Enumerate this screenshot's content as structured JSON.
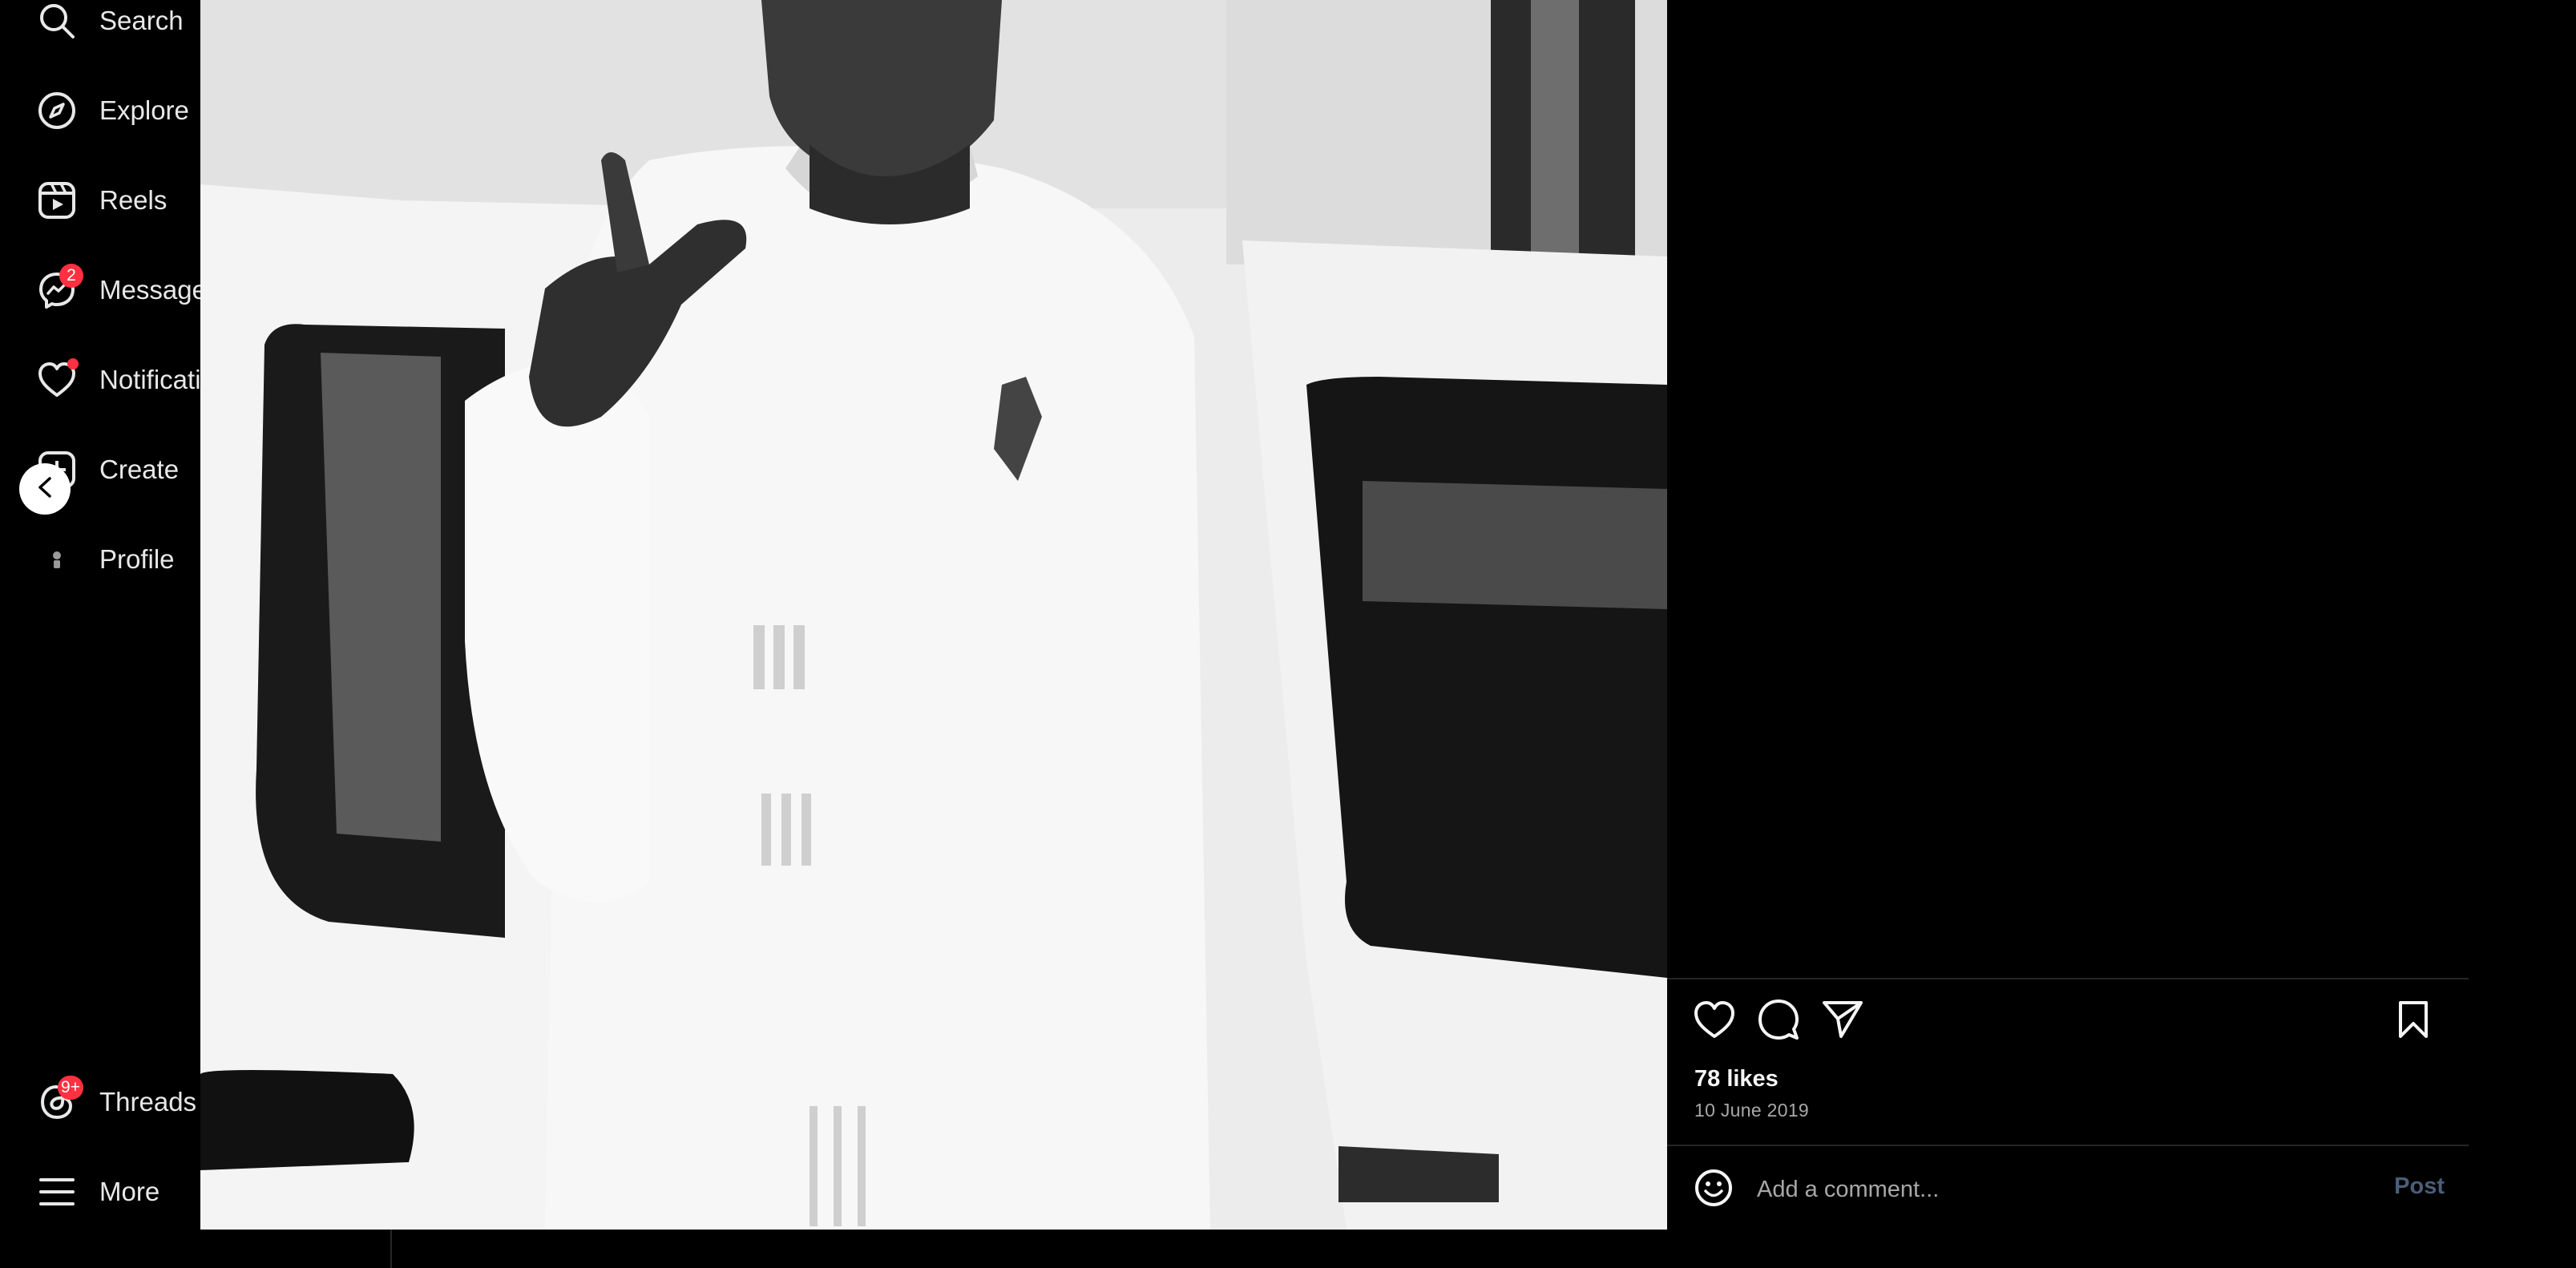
{
  "sidebar": {
    "items": [
      {
        "label": "Search",
        "icon": "search-icon"
      },
      {
        "label": "Explore",
        "icon": "compass-icon"
      },
      {
        "label": "Reels",
        "icon": "reels-icon"
      },
      {
        "label": "Messages",
        "icon": "messenger-icon",
        "badge": "2"
      },
      {
        "label": "Notifications",
        "icon": "heart-icon"
      },
      {
        "label": "Create",
        "icon": "plus-square-icon"
      },
      {
        "label": "Profile",
        "icon": "avatar"
      },
      {
        "label": "Threads",
        "icon": "threads-icon",
        "badge": "9+"
      },
      {
        "label": "More",
        "icon": "hamburger-icon"
      }
    ]
  },
  "post": {
    "likes": "78 likes",
    "date": "10 June 2019",
    "comment_placeholder": "Add a comment...",
    "post_label": "Post"
  },
  "colors": {
    "background": "#000000",
    "badge": "#ff3040",
    "post_button": "#4a5e7a",
    "muted_text": "#a8a8a8"
  }
}
